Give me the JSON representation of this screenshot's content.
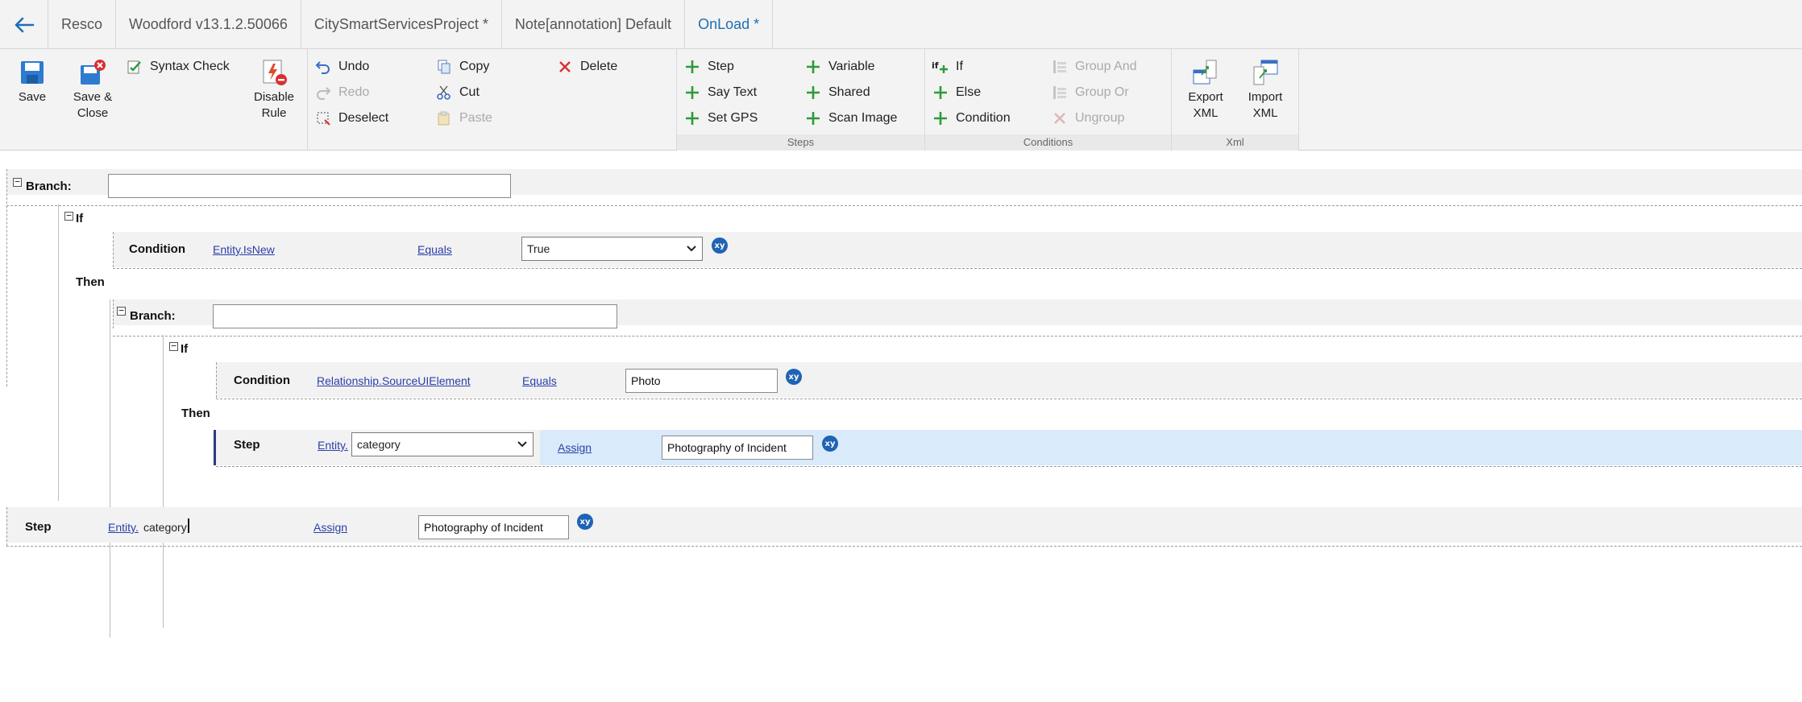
{
  "breadcrumbs": [
    "Resco",
    "Woodford v13.1.2.50066",
    "CitySmartServicesProject *",
    "Note[annotation] Default",
    "OnLoad *"
  ],
  "ribbon": {
    "save": "Save",
    "save_close": "Save &\nClose",
    "syntax_check": "Syntax Check",
    "disable_rule": "Disable\nRule",
    "undo": "Undo",
    "redo": "Redo",
    "deselect": "Deselect",
    "copy": "Copy",
    "cut": "Cut",
    "paste": "Paste",
    "delete": "Delete",
    "steps_group": "Steps",
    "step": "Step",
    "say_text": "Say Text",
    "set_gps": "Set GPS",
    "variable": "Variable",
    "shared": "Shared",
    "scan_image": "Scan Image",
    "conditions_group": "Conditions",
    "if": "If",
    "else": "Else",
    "condition": "Condition",
    "group_and": "Group And",
    "group_or": "Group Or",
    "ungroup": "Ungroup",
    "xml_group": "Xml",
    "export_xml": "Export\nXML",
    "import_xml": "Import\nXML"
  },
  "editor": {
    "branch_label": "Branch:",
    "if_label": "If",
    "then_label": "Then",
    "condition_label": "Condition",
    "step_label": "Step",
    "branch1_name": "",
    "branch2_name": "",
    "cond1": {
      "field": "Entity.IsNew",
      "operator": "Equals",
      "value": "True"
    },
    "cond2": {
      "field": "Relationship.SourceUIElement",
      "operator": "Equals",
      "value": "Photo"
    },
    "step1": {
      "prefix": "Entity.",
      "field": "category",
      "action": "Assign",
      "value": "Photography of Incident"
    },
    "step2": {
      "prefix": "Entity.",
      "field": "category",
      "action": "Assign",
      "value": "Photography of Incident"
    },
    "xy": "xy"
  }
}
